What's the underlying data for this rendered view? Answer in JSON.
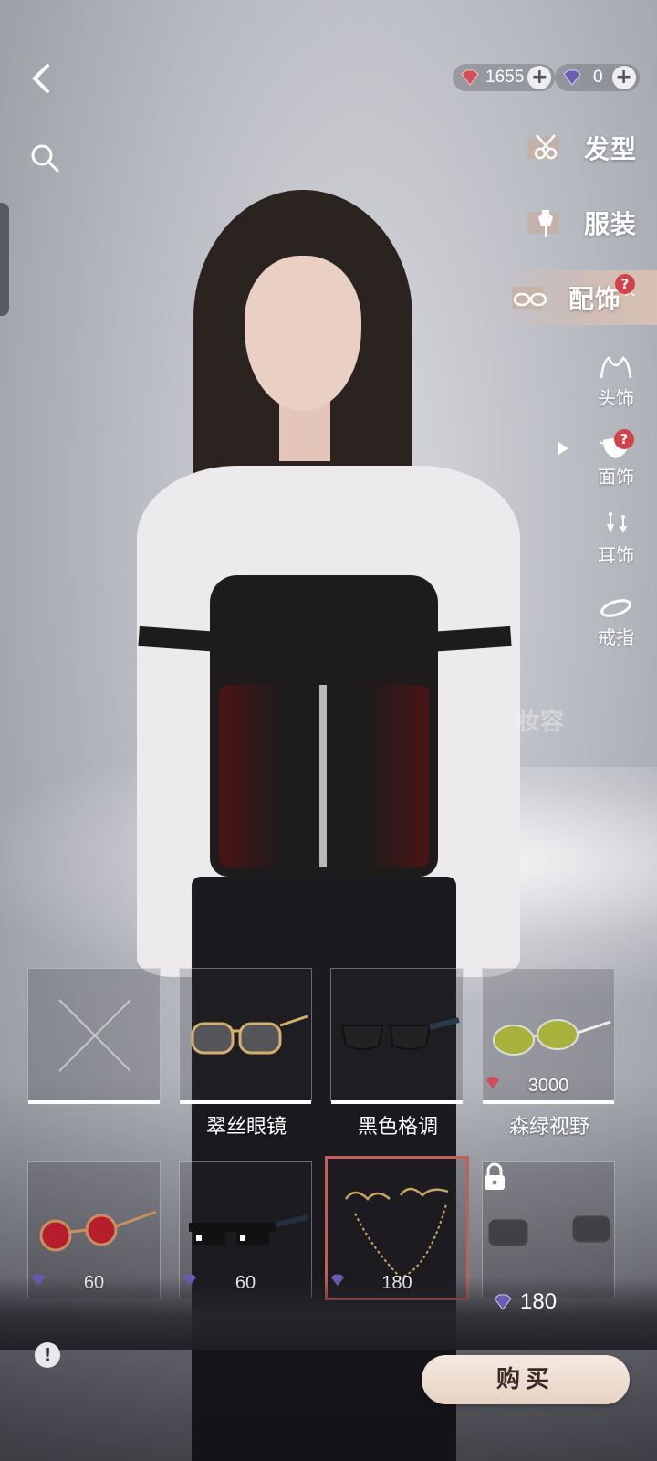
{
  "currency": {
    "primary_amount": "1655",
    "secondary_amount": "0",
    "primary_gem_color": "#c8505a",
    "secondary_gem_color": "#6a5aa8"
  },
  "categories": [
    {
      "label": "发型",
      "icon": "scissors-icon"
    },
    {
      "label": "服装",
      "icon": "dress-form-icon"
    },
    {
      "label": "配饰",
      "icon": "glasses-icon",
      "active": true,
      "badge": "?",
      "caret": "^"
    }
  ],
  "subcategories": [
    {
      "label": "头饰",
      "icon": "cat-ears-icon"
    },
    {
      "label": "面饰",
      "icon": "mask-icon",
      "active": true,
      "badge": "?"
    },
    {
      "label": "耳饰",
      "icon": "earring-icon"
    },
    {
      "label": "戒指",
      "icon": "ring-icon"
    }
  ],
  "makeup_label": "妆容",
  "items_row1": [
    {
      "name": "",
      "price": "",
      "icon": "none-icon"
    },
    {
      "name": "翠丝眼镜",
      "price": "",
      "icon": "gold-glasses-icon"
    },
    {
      "name": "黑色格调",
      "price": "",
      "icon": "black-glasses-icon"
    },
    {
      "name": "森绿视野",
      "price": "3000",
      "icon": "green-glasses-icon"
    }
  ],
  "items_row2": [
    {
      "price": "60",
      "icon": "red-round-glasses-icon"
    },
    {
      "price": "60",
      "icon": "pixel-sunglasses-icon"
    },
    {
      "price": "180",
      "icon": "glasses-chain-icon",
      "selected": true
    },
    {
      "price": "",
      "icon": "lock-icon",
      "locked": true
    }
  ],
  "total_price": "180",
  "buy_label": "购买",
  "info_symbol": "!",
  "plus_symbol": "+",
  "accent_color": "#c06058"
}
